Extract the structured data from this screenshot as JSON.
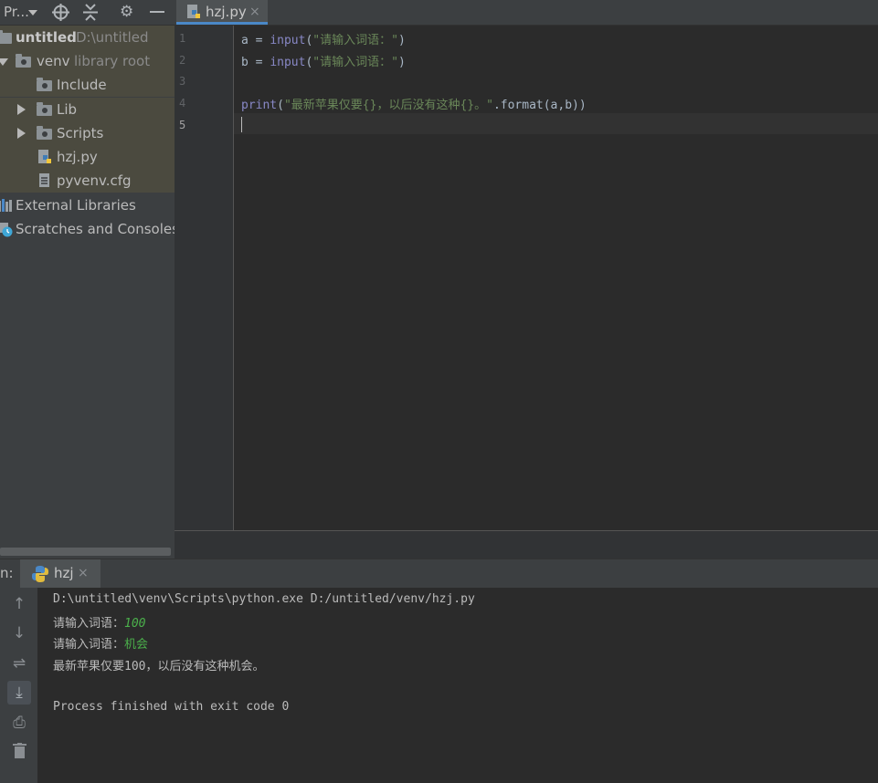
{
  "project_toolbar": {
    "title": "Pr...",
    "icons": [
      "dropdown-icon",
      "target-icon",
      "collapse-icon",
      "gear-icon",
      "minimize-icon"
    ]
  },
  "tree": {
    "root": {
      "label": "untitled",
      "path": "D:\\untitled"
    },
    "venv": {
      "label": "venv",
      "note": "library root"
    },
    "children": [
      "Include",
      "Lib",
      "Scripts",
      "hzj.py",
      "pyvenv.cfg"
    ],
    "external": "External Libraries",
    "scratches": "Scratches and Consoles"
  },
  "editor": {
    "tab_label": "hzj.py",
    "line_numbers": [
      "1",
      "2",
      "3",
      "4",
      "5"
    ],
    "code": {
      "l1_a": "a = ",
      "l1_fn": "input",
      "l1_open": "(",
      "l1_str": "\"请输入词语：\"",
      "l1_close": ")",
      "l2_a": "b = ",
      "l2_fn": "input",
      "l2_open": "(",
      "l2_str": "\"请输入词语：\"",
      "l2_close": ")",
      "l4_fn": "print",
      "l4_open": "(",
      "l4_str": "\"最新苹果仅要{}，以后没有这种{}。\"",
      "l4_rest": ".format(a,b))"
    }
  },
  "run": {
    "label_prefix": "n:",
    "tab_label": "hzj",
    "console": {
      "cmd": "D:\\untitled\\venv\\Scripts\\python.exe D:/untitled/venv/hzj.py",
      "prompt1": "请输入词语：",
      "input1": "100",
      "prompt2": "请输入词语：",
      "input2": "机会",
      "result": "最新苹果仅要100，以后没有这种机会。",
      "exit": "Process finished with exit code 0"
    }
  }
}
